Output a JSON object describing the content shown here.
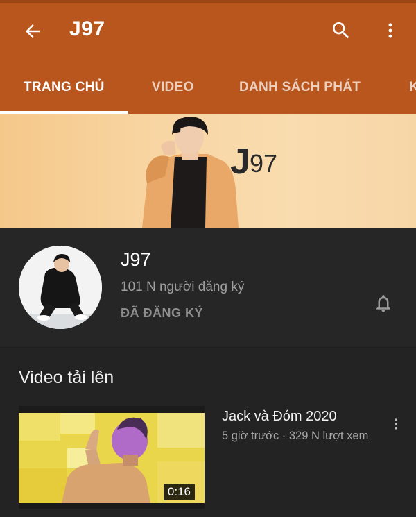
{
  "appbar": {
    "title": "J97",
    "background_color": "#b8561d",
    "icons": [
      "arrow-back-icon",
      "search-icon",
      "more-vert-icon"
    ]
  },
  "tabs": [
    {
      "label": "TRANG CHỦ",
      "active": true
    },
    {
      "label": "VIDEO",
      "active": false
    },
    {
      "label": "DANH SÁCH PHÁT",
      "active": false
    },
    {
      "label": "K",
      "active": false
    }
  ],
  "banner": {
    "text": "J97"
  },
  "channel": {
    "name": "J97",
    "subscribers": "101 N người đăng ký",
    "subscribed_label": "ĐÃ ĐĂNG KÝ",
    "bell_icon": "bell-icon"
  },
  "uploads": {
    "section_title": "Video tải lên",
    "videos": [
      {
        "title": "Jack và Đóm 2020",
        "meta": "5 giờ trước · 329 N lượt xem",
        "duration": "0:16"
      }
    ]
  }
}
